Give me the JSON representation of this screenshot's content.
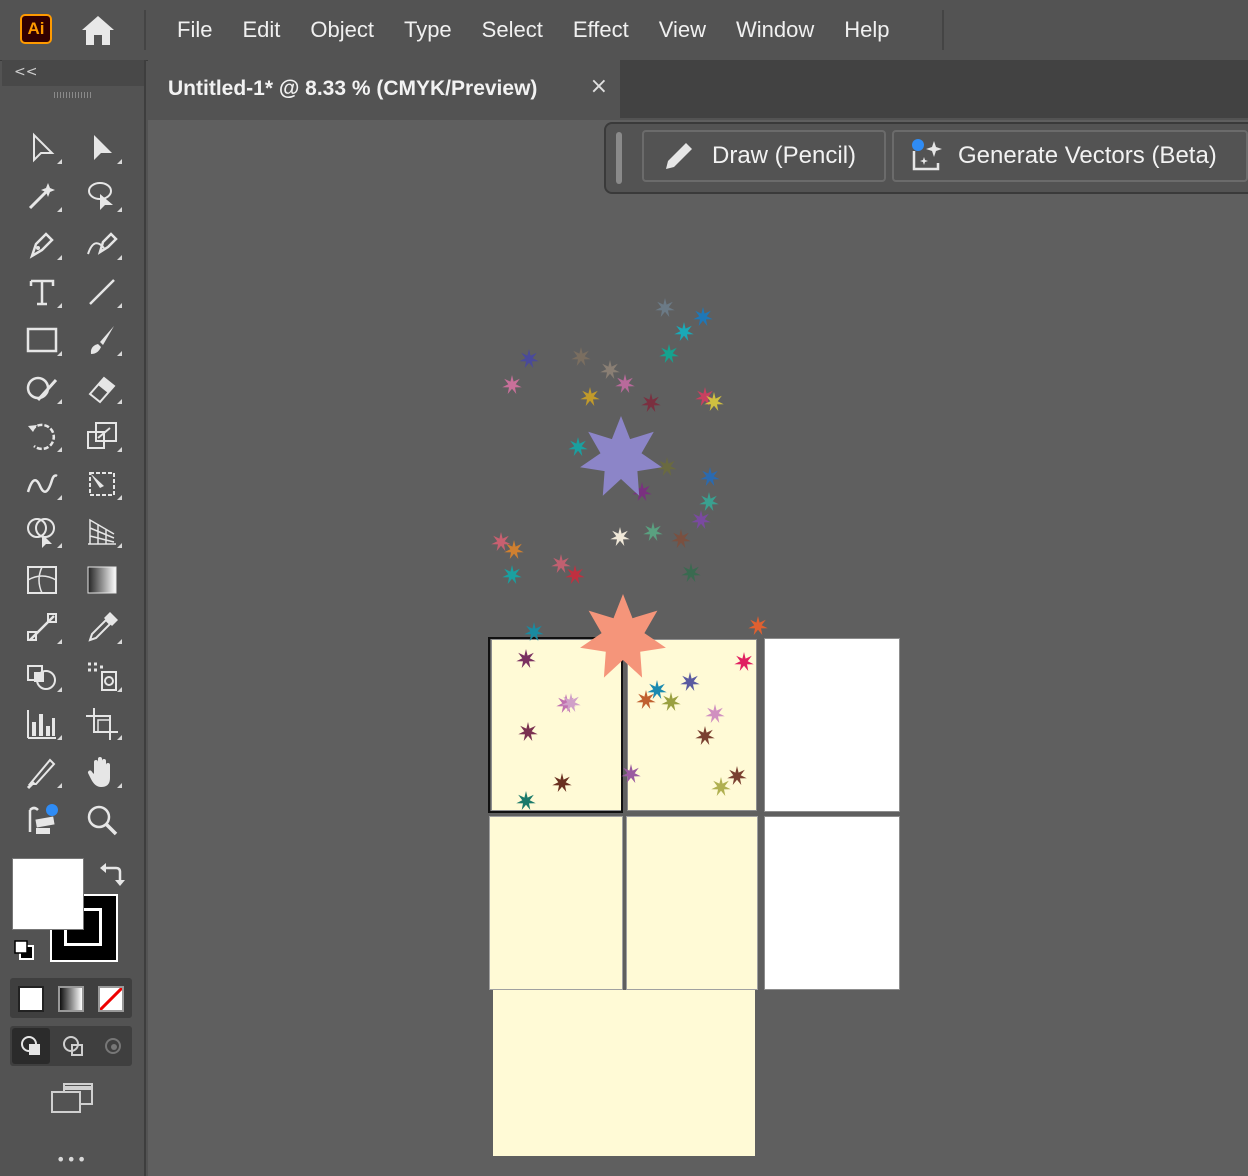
{
  "app": {
    "logo_text": "Ai"
  },
  "menu": {
    "items": [
      "File",
      "Edit",
      "Object",
      "Type",
      "Select",
      "Effect",
      "View",
      "Window",
      "Help"
    ]
  },
  "toolbar": {
    "collapse_label": "<<"
  },
  "document": {
    "tab_title": "Untitled-1* @ 8.33 % (CMYK/Preview)",
    "close_label": "×"
  },
  "context_bar": {
    "draw_label": "Draw (Pencil)",
    "generate_label": "Generate Vectors (Beta)"
  },
  "bottom": {
    "more_label": "•••"
  },
  "colors": {
    "fill": "#ffffff",
    "stroke": "#000000",
    "artboard_cream": "#fffad6",
    "accent_blue": "#2f8cf5"
  }
}
